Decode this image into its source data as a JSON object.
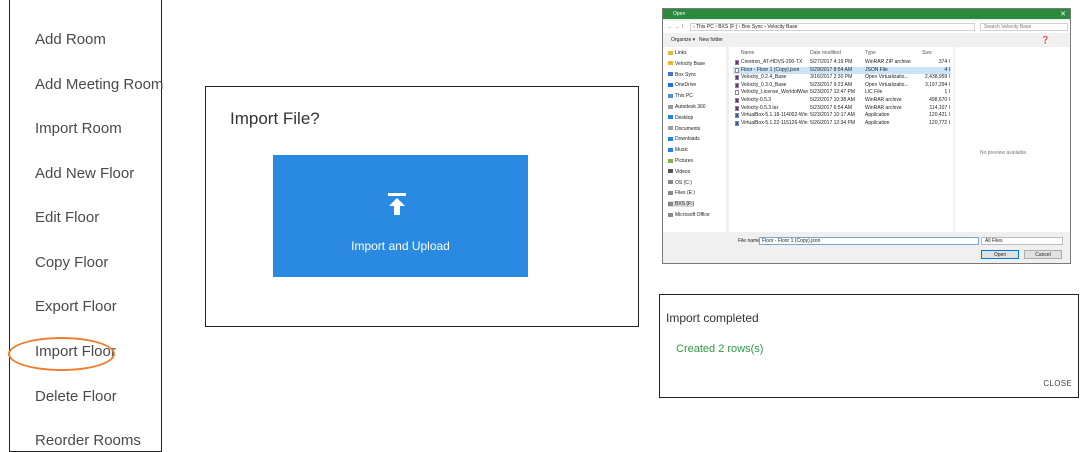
{
  "menu": {
    "items": [
      {
        "label": "Add Room"
      },
      {
        "label": "Add Meeting Room"
      },
      {
        "label": "Import Room"
      },
      {
        "label": "Add New Floor"
      },
      {
        "label": "Edit Floor"
      },
      {
        "label": "Copy Floor"
      },
      {
        "label": "Export Floor"
      },
      {
        "label": "Import Floor",
        "highlighted": true
      },
      {
        "label": "Delete Floor"
      },
      {
        "label": "Reorder Rooms"
      }
    ],
    "highlight_color": "#ef7d2c"
  },
  "import_dialog": {
    "title": "Import File?",
    "button_label": "Import and Upload",
    "button_color": "#2a8ae1",
    "icon": "upload-icon"
  },
  "open_dialog": {
    "title": "Open",
    "breadcrumb": "› This PC › BXS (F:) › Box Sync › Velocity Base",
    "search_placeholder": "Search Velocity Base",
    "organize": "Organize ▾",
    "new_folder": "New folder",
    "nav_items": [
      "Links",
      "Velocity Base",
      "Box Sync",
      "OneDrive",
      "This PC",
      "Autodesk 360",
      "Desktop",
      "Documents",
      "Downloads",
      "Music",
      "Pictures",
      "Videos",
      "OS (C:)",
      "Files (E:)",
      "BXS (F:)",
      "Microsoft Office"
    ],
    "columns": [
      "Name",
      "Date modified",
      "Type",
      "Size"
    ],
    "files": [
      {
        "name": "Crestron_AT-HDVS-200-TX",
        "date": "5/27/2017 4:19 PM",
        "type": "WinRAR ZIP archive",
        "size": "374 I"
      },
      {
        "name": "Floor - Floor 1 (Copy).json",
        "date": "5/29/2017 8:54 AM",
        "type": "JSON File",
        "size": "4 I",
        "selected": true
      },
      {
        "name": "Velocity_0.2.4_Base",
        "date": "3/16/2017 2:30 PM",
        "type": "Open Virtualizatio...",
        "size": "2,438,959 I"
      },
      {
        "name": "Velocity_0.3.0_Base",
        "date": "5/23/2017 9:23 AM",
        "type": "Open Virtualizatio...",
        "size": "3,197,294 I"
      },
      {
        "name": "Velocity_License_WorldofWarcraft.lic",
        "date": "5/23/2017 12:47 PM",
        "type": "LIC File",
        "size": "1 I"
      },
      {
        "name": "Velocity-0.5.3",
        "date": "5/22/2017 10:38 AM",
        "type": "WinRAR archive",
        "size": "498,670 I"
      },
      {
        "name": "Velocity-0.5.3.tar",
        "date": "5/23/2017 6:54 AM",
        "type": "WinRAR archive",
        "size": "114,107 I"
      },
      {
        "name": "VirtualBox-5.1.18-114002-Win",
        "date": "5/23/2017 10:17 AM",
        "type": "Application",
        "size": "120,421 I"
      },
      {
        "name": "VirtualBox-5.1.22-115126-Win",
        "date": "5/26/2017 12:34 PM",
        "type": "Application",
        "size": "120,772 I"
      }
    ],
    "preview_text": "No preview available.",
    "file_name_label": "File name:",
    "file_name_value": "Floor - Floor 1 (Copy).json",
    "filter": "All Files",
    "open_label": "Open",
    "cancel_label": "Cancel"
  },
  "completed": {
    "title": "Import completed",
    "message": "Created 2 rows(s)",
    "close_label": "CLOSE"
  }
}
